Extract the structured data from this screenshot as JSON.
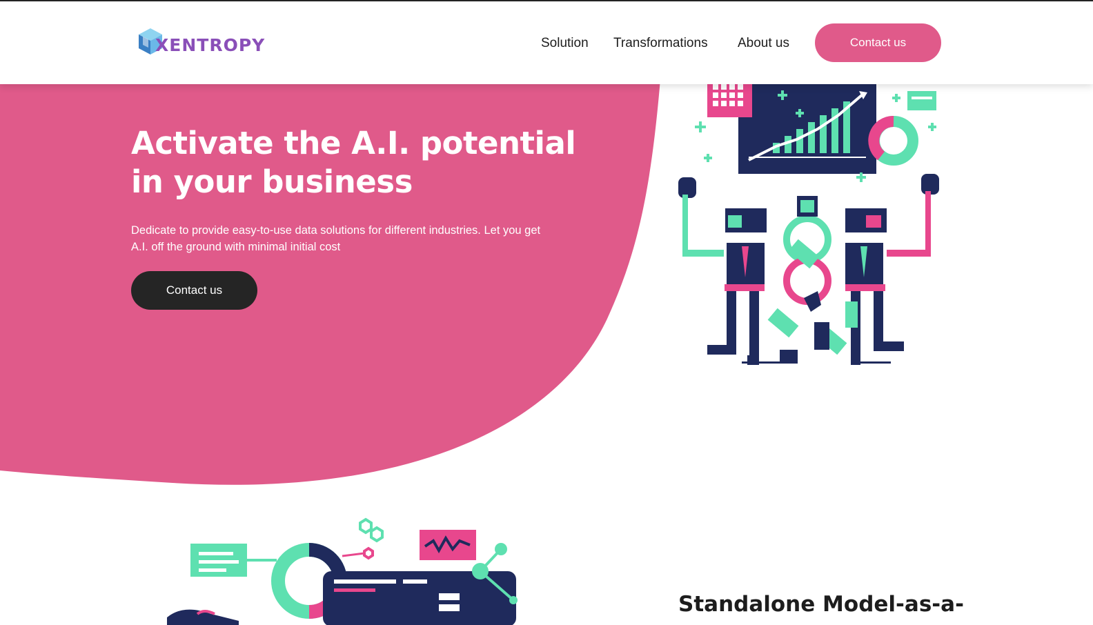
{
  "brand": {
    "logo_text": "XENTROPY"
  },
  "nav": {
    "items": [
      "Solution",
      "Transformations",
      "About us"
    ],
    "contact_label": "Contact us"
  },
  "hero": {
    "title": "Activate the A.I. potential in your business",
    "description": "Dedicate to provide easy-to-use data solutions for different industries. Let you get A.I. off the ground with minimal initial cost",
    "cta_label": "Contact us"
  },
  "section2": {
    "title": "Standalone Model-as-a-"
  },
  "colors": {
    "accent_pink": "#e05a8a",
    "dark": "#252525",
    "navy": "#1f2a5c",
    "mint": "#5ee0b0",
    "pink_illustration": "#e8478d"
  },
  "icons": {
    "logo": "cube-logo-icon",
    "hero_illustration": "robots-handshake-illustration",
    "section_illustration": "data-dashboard-illustration"
  }
}
